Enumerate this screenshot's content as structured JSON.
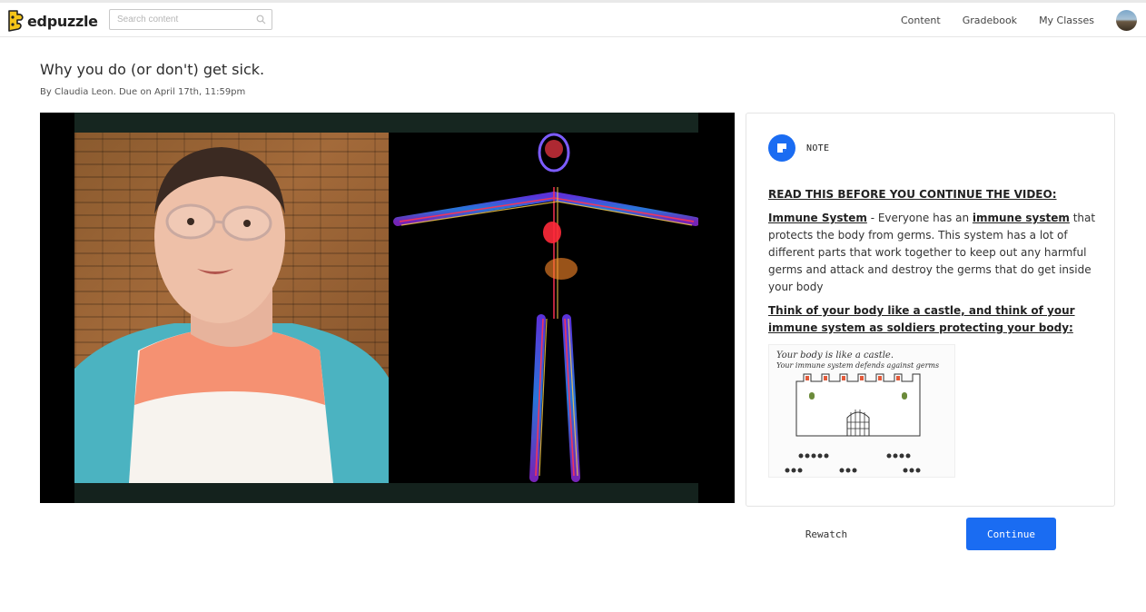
{
  "header": {
    "brand": "edpuzzle",
    "search_placeholder": "Search content",
    "nav": [
      "Content",
      "Gradebook",
      "My Classes"
    ]
  },
  "assignment": {
    "title": "Why you do (or don't) get sick.",
    "subtitle": "By Claudia Leon. Due on April 17th, 11:59pm"
  },
  "note": {
    "label": "NOTE",
    "heading": "READ THIS BEFORE YOU CONTINUE THE VIDEO:",
    "term": "Immune System",
    "dash": " - Everyone has an ",
    "term2": "immune system",
    "body": " that protects the body from germs. This system has a lot of different parts that work together to keep out any harmful germs and attack and destroy the germs that do get inside your body",
    "subheading": "Think of your body like a castle, and think of your immune system as soldiers protecting your body:",
    "image_text_1": "Your body is like a castle.",
    "image_text_2": "Your immune system defends against germs"
  },
  "actions": {
    "rewatch": "Rewatch",
    "continue": "Continue"
  },
  "colors": {
    "accent": "#1a6cf2",
    "logo_yellow": "#f5c518"
  }
}
